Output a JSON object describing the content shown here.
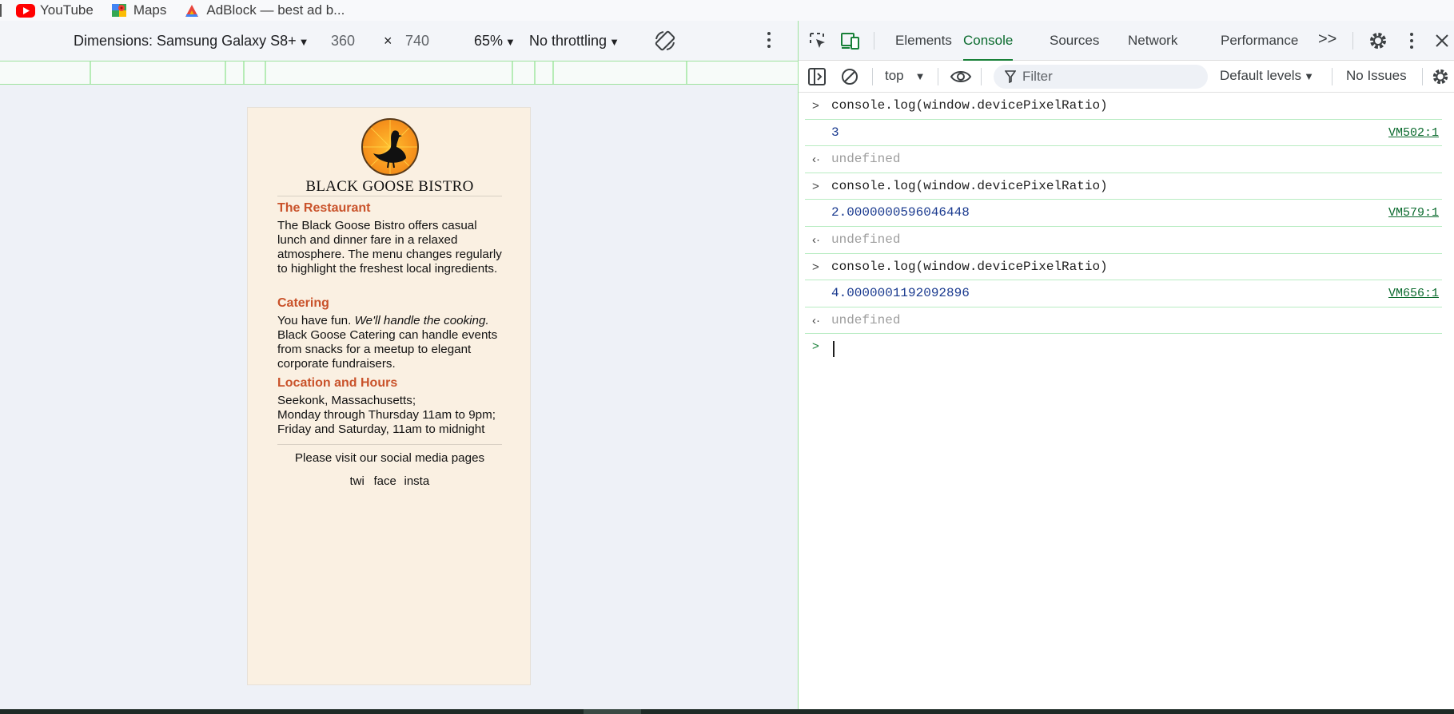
{
  "bookmarks": [
    {
      "label": "YouTube",
      "icon": "youtube-icon"
    },
    {
      "label": "Maps",
      "icon": "maps-icon"
    },
    {
      "label": "AdBlock — best ad b...",
      "icon": "adblock-icon"
    }
  ],
  "device_toolbar": {
    "dimensions_label": "Dimensions: Samsung Galaxy S8+",
    "width": "360",
    "times": "×",
    "height": "740",
    "zoom": "65%",
    "throttling": "No throttling"
  },
  "site": {
    "title": "BLACK GOOSE BISTRO",
    "sections": [
      {
        "heading": "The Restaurant",
        "body": "The Black Goose Bistro offers casual lunch and dinner fare in a relaxed atmosphere. The menu changes regularly to highlight the freshest local ingredients."
      },
      {
        "heading": "Catering",
        "body_plain": "You have fun. ",
        "body_em": "We'll handle the cooking.",
        "body_rest": " Black Goose Catering can handle events from snacks for a meetup to elegant corporate fundraisers."
      },
      {
        "heading": "Location and Hours",
        "lines": [
          "Seekonk, Massachusetts;",
          "Monday through Thursday 11am to 9pm;",
          "Friday and Saturday, 11am to midnight"
        ]
      }
    ],
    "social_text": "Please visit our social media pages",
    "social_alts": [
      "twi",
      "face",
      "insta"
    ]
  },
  "devtools": {
    "tabs": [
      "Elements",
      "Console",
      "Sources",
      "Network",
      "Performance"
    ],
    "active_tab": "Console",
    "more_tabs": ">>",
    "context": "top",
    "filter_placeholder": "Filter",
    "levels": "Default levels",
    "issues": "No Issues",
    "console": [
      {
        "type": "cmd",
        "text": "console.log(window.devicePixelRatio)"
      },
      {
        "type": "val",
        "text": "3",
        "src": "VM502:1"
      },
      {
        "type": "ret",
        "text": "undefined"
      },
      {
        "type": "cmd",
        "text": "console.log(window.devicePixelRatio)"
      },
      {
        "type": "val",
        "text": "2.0000000596046448",
        "src": "VM579:1"
      },
      {
        "type": "ret",
        "text": "undefined"
      },
      {
        "type": "cmd",
        "text": "console.log(window.devicePixelRatio)"
      },
      {
        "type": "val",
        "text": "4.0000001192092896",
        "src": "VM656:1"
      },
      {
        "type": "ret",
        "text": "undefined"
      }
    ]
  },
  "colors": {
    "accent_green": "#188038",
    "heading_orange": "#c9522a",
    "page_bg": "#faf0e2"
  }
}
